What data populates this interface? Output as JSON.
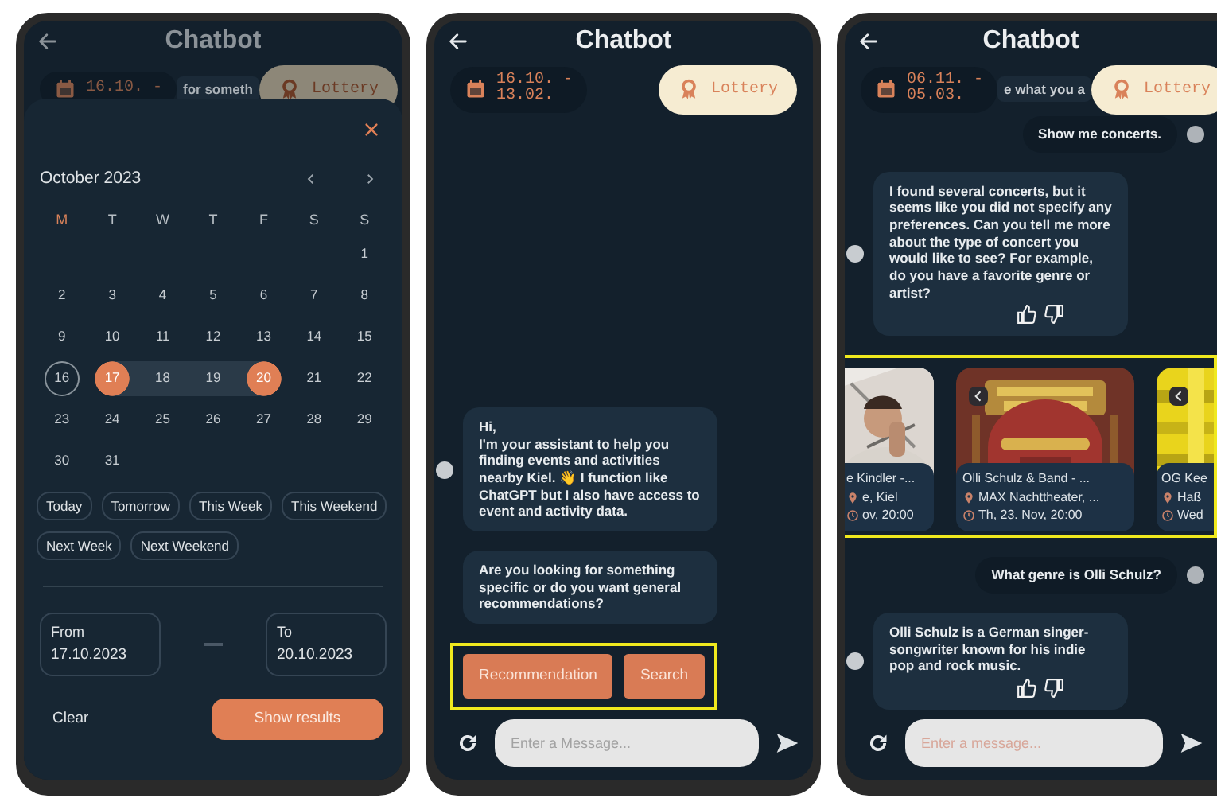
{
  "screens": [
    {
      "kind": "calendar",
      "header": {
        "title": "Chatbot"
      },
      "date_chip": {
        "lines": [
          "16.10. -"
        ]
      },
      "peek_text": "for someth",
      "lottery_button": {
        "label": "Lottery"
      },
      "sheet": {
        "month": "October 2023",
        "weekdays": [
          {
            "label": "M",
            "highlighted": true
          },
          {
            "label": "T",
            "highlighted": false
          },
          {
            "label": "W",
            "highlighted": false
          },
          {
            "label": "T",
            "highlighted": false
          },
          {
            "label": "F",
            "highlighted": false
          },
          {
            "label": "S",
            "highlighted": false
          },
          {
            "label": "S",
            "highlighted": false
          }
        ],
        "weeks": [
          [
            {
              "label": "1",
              "selected": false,
              "in_range": false,
              "today": false
            }
          ],
          [
            {
              "label": "2",
              "selected": false,
              "in_range": false,
              "today": false
            },
            {
              "label": "3",
              "selected": false,
              "in_range": false,
              "today": false
            },
            {
              "label": "4",
              "selected": false,
              "in_range": false,
              "today": false
            },
            {
              "label": "5",
              "selected": false,
              "in_range": false,
              "today": false
            },
            {
              "label": "6",
              "selected": false,
              "in_range": false,
              "today": false
            },
            {
              "label": "7",
              "selected": false,
              "in_range": false,
              "today": false
            },
            {
              "label": "8",
              "selected": false,
              "in_range": false,
              "today": false
            }
          ],
          [
            {
              "label": "9",
              "selected": false,
              "in_range": false,
              "today": false
            },
            {
              "label": "10",
              "selected": false,
              "in_range": false,
              "today": false
            },
            {
              "label": "11",
              "selected": false,
              "in_range": false,
              "today": false
            },
            {
              "label": "12",
              "selected": false,
              "in_range": false,
              "today": false
            },
            {
              "label": "13",
              "selected": false,
              "in_range": false,
              "today": false
            },
            {
              "label": "14",
              "selected": false,
              "in_range": false,
              "today": false
            },
            {
              "label": "15",
              "selected": false,
              "in_range": false,
              "today": false
            }
          ],
          [
            {
              "label": "16",
              "selected": false,
              "in_range": false,
              "today": true
            },
            {
              "label": "17",
              "selected": true,
              "in_range": false,
              "today": false
            },
            {
              "label": "18",
              "selected": false,
              "in_range": true,
              "today": false
            },
            {
              "label": "19",
              "selected": false,
              "in_range": true,
              "today": false
            },
            {
              "label": "20",
              "selected": true,
              "in_range": false,
              "today": false
            },
            {
              "label": "21",
              "selected": false,
              "in_range": false,
              "today": false
            },
            {
              "label": "22",
              "selected": false,
              "in_range": false,
              "today": false
            }
          ],
          [
            {
              "label": "23",
              "selected": false,
              "in_range": false,
              "today": false
            },
            {
              "label": "24",
              "selected": false,
              "in_range": false,
              "today": false
            },
            {
              "label": "25",
              "selected": false,
              "in_range": false,
              "today": false
            },
            {
              "label": "26",
              "selected": false,
              "in_range": false,
              "today": false
            },
            {
              "label": "27",
              "selected": false,
              "in_range": false,
              "today": false
            },
            {
              "label": "28",
              "selected": false,
              "in_range": false,
              "today": false
            },
            {
              "label": "29",
              "selected": false,
              "in_range": false,
              "today": false
            }
          ],
          [
            {
              "label": "30",
              "selected": false,
              "in_range": false,
              "today": false
            },
            {
              "label": "31",
              "selected": false,
              "in_range": false,
              "today": false
            }
          ]
        ],
        "quick_ranges": [
          {
            "label": "Today",
            "selected": false
          },
          {
            "label": "Tomorrow",
            "selected": false
          },
          {
            "label": "This Week",
            "selected": false
          },
          {
            "label": "This Weekend",
            "selected": false
          },
          {
            "label": "Next Week",
            "selected": false
          },
          {
            "label": "Next Weekend",
            "selected": false
          }
        ],
        "from": {
          "label": "From",
          "value": "17.10.2023"
        },
        "to": {
          "label": "To",
          "value": "20.10.2023"
        },
        "clear_button": "Clear",
        "submit_button": "Show results"
      }
    },
    {
      "kind": "chat",
      "header": {
        "title": "Chatbot"
      },
      "date_chip": {
        "lines": [
          "16.10. -",
          "13.02."
        ]
      },
      "lottery_button": {
        "label": "Lottery"
      },
      "messages": [
        {
          "kind": "bot",
          "avatar": true,
          "feedback": false,
          "text": "Hi,\nI'm your assistant to help you finding events and activities nearby Kiel. 👋 I function like ChatGPT but I also have access to event and activity data."
        },
        {
          "kind": "bot",
          "avatar": false,
          "feedback": false,
          "text": "Are you looking for something specific or do you want general recommendations?"
        },
        {
          "kind": "quick_replies",
          "highlighted": true,
          "buttons": [
            "Recommendation",
            "Search"
          ]
        }
      ],
      "input": {
        "placeholder": "Enter a Message..."
      }
    },
    {
      "kind": "chat",
      "header": {
        "title": "Chatbot"
      },
      "date_chip": {
        "lines": [
          "06.11. -",
          "05.03."
        ]
      },
      "peek_text": "e what you a",
      "lottery_button": {
        "label": "Lottery"
      },
      "messages": [
        {
          "kind": "user",
          "text": "Show me concerts."
        },
        {
          "kind": "bot",
          "avatar": true,
          "feedback": true,
          "text": "I found several concerts, but it seems like you did not specify any preferences. Can you tell me more about the type of concert you would like to see? For example, do you have a favorite genre or artist?"
        },
        {
          "kind": "events",
          "highlighted": true,
          "cards": [
            {
              "kind": "picture",
              "title": "e Kindler -...",
              "place": "e, Kiel",
              "time": "ov, 20:00"
            },
            {
              "kind": "picture",
              "title": "Olli Schulz & Band - ...",
              "place": "MAX Nachttheater, ...",
              "time": "Th, 23. Nov, 20:00"
            },
            {
              "kind": "picture",
              "title": "OG Kee",
              "place": "Haß",
              "time": "Wed"
            }
          ]
        },
        {
          "kind": "user",
          "text": "What genre is Olli Schulz?"
        },
        {
          "kind": "bot",
          "avatar": true,
          "feedback": true,
          "text": "Olli Schulz is a German singer-songwriter known for his indie pop and rock music."
        }
      ],
      "input": {
        "placeholder": "Enter a message..."
      }
    }
  ]
}
